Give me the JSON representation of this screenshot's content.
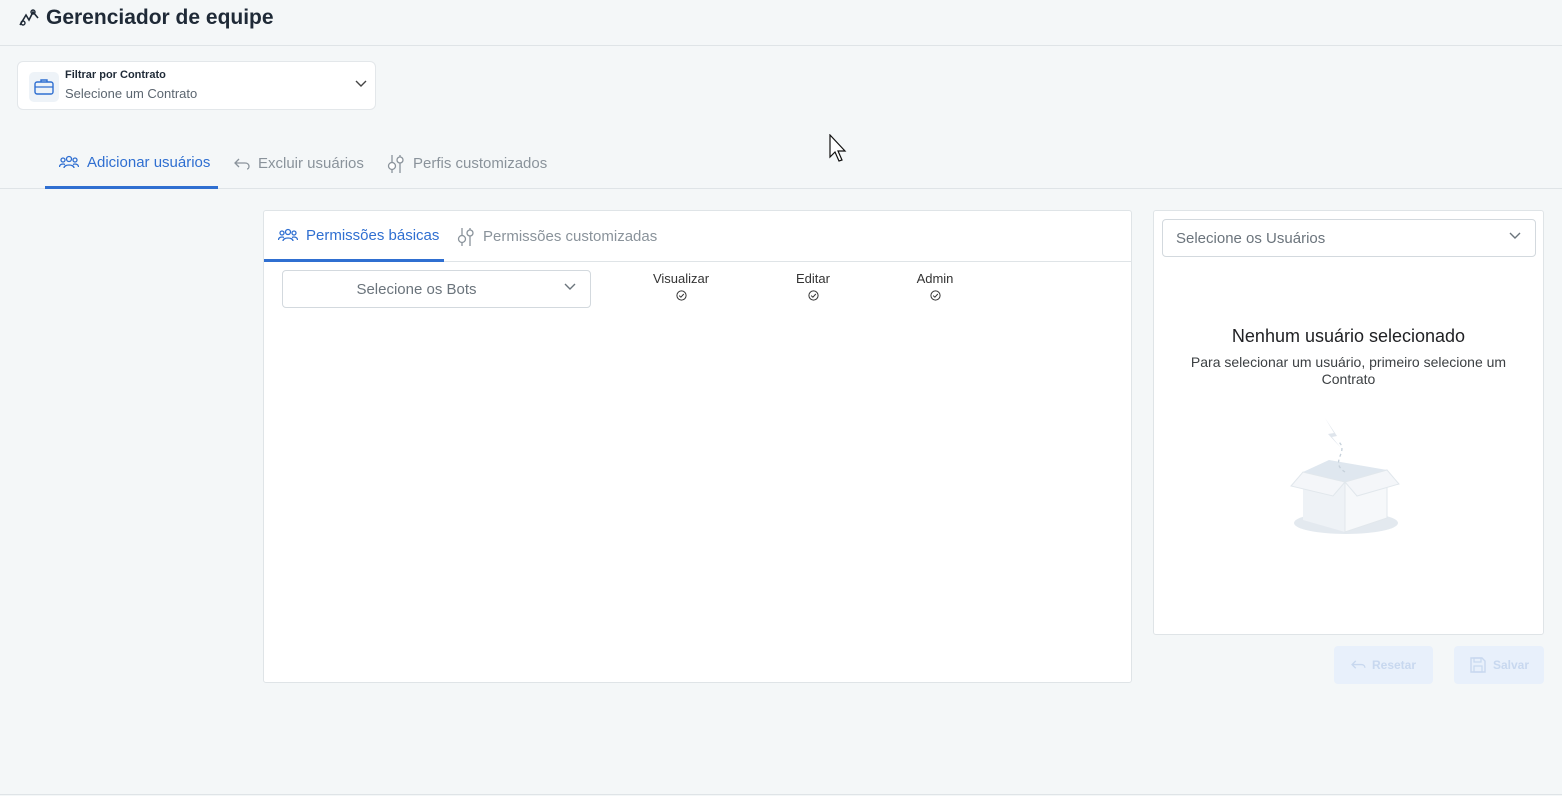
{
  "header": {
    "title": "Gerenciador de equipe"
  },
  "contract_filter": {
    "label": "Filtrar por Contrato",
    "placeholder": "Selecione um Contrato"
  },
  "main_tabs": [
    {
      "label": "Adicionar usuários",
      "icon": "users-icon",
      "active": true
    },
    {
      "label": "Excluir usuários",
      "icon": "undo-icon",
      "active": false
    },
    {
      "label": "Perfis customizados",
      "icon": "sliders-icon",
      "active": false
    }
  ],
  "permissions": {
    "tabs": [
      {
        "label": "Permissões básicas",
        "icon": "users-icon",
        "active": true
      },
      {
        "label": "Permissões customizadas",
        "icon": "sliders-icon",
        "active": false
      }
    ],
    "bots_select": "Selecione os Bots",
    "columns": [
      "Visualizar",
      "Editar",
      "Admin"
    ]
  },
  "users_panel": {
    "select_placeholder": "Selecione os Usuários",
    "empty_title": "Nenhum usuário selecionado",
    "empty_description": "Para selecionar um usuário, primeiro selecione um Contrato"
  },
  "actions": {
    "reset_label": "Resetar",
    "save_label": "Salvar"
  },
  "colors": {
    "accent": "#2f6fd1",
    "background": "#f4f7f8",
    "disabled_button": "#e8f0fb"
  }
}
